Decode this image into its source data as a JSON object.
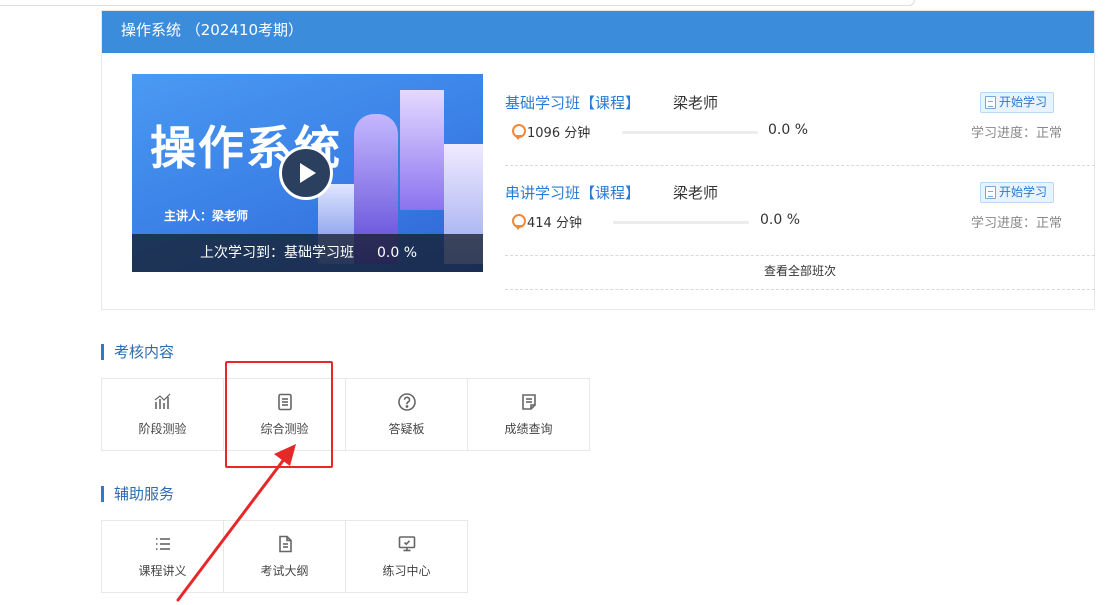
{
  "card": {
    "title": "操作系统 （202410考期）",
    "thumbnail": {
      "title": "操作系统",
      "lecturer": "主讲人：梁老师",
      "last_study_label": "上次学习到：基础学习班",
      "last_study_percent": "0.0 %"
    },
    "courses": [
      {
        "name": "基础学习班【课程】",
        "teacher": "梁老师",
        "start_label": "开始学习",
        "minutes": "1096 分钟",
        "percent": "0.0 %",
        "progress": 0.0,
        "status": "学习进度：正常"
      },
      {
        "name": "串讲学习班【课程】",
        "teacher": "梁老师",
        "start_label": "开始学习",
        "minutes": "414 分钟",
        "percent": "0.0 %",
        "progress": 0.0,
        "status": "学习进度：正常"
      }
    ],
    "view_all": "查看全部班次"
  },
  "sections": {
    "assessment": {
      "title": "考核内容",
      "items": [
        {
          "label": "阶段测验",
          "icon": "bar-chart-icon"
        },
        {
          "label": "综合测验",
          "icon": "document-icon"
        },
        {
          "label": "答疑板",
          "icon": "question-circle-icon"
        },
        {
          "label": "成绩查询",
          "icon": "report-icon"
        }
      ]
    },
    "services": {
      "title": "辅助服务",
      "items": [
        {
          "label": "课程讲义",
          "icon": "list-icon"
        },
        {
          "label": "考试大纲",
          "icon": "file-text-icon"
        },
        {
          "label": "练习中心",
          "icon": "monitor-icon"
        }
      ]
    }
  },
  "colors": {
    "header_blue": "#3b8ddc",
    "link_blue": "#2b7ad3",
    "annotation_red": "#e62828",
    "medal_orange": "#f08a3a"
  }
}
